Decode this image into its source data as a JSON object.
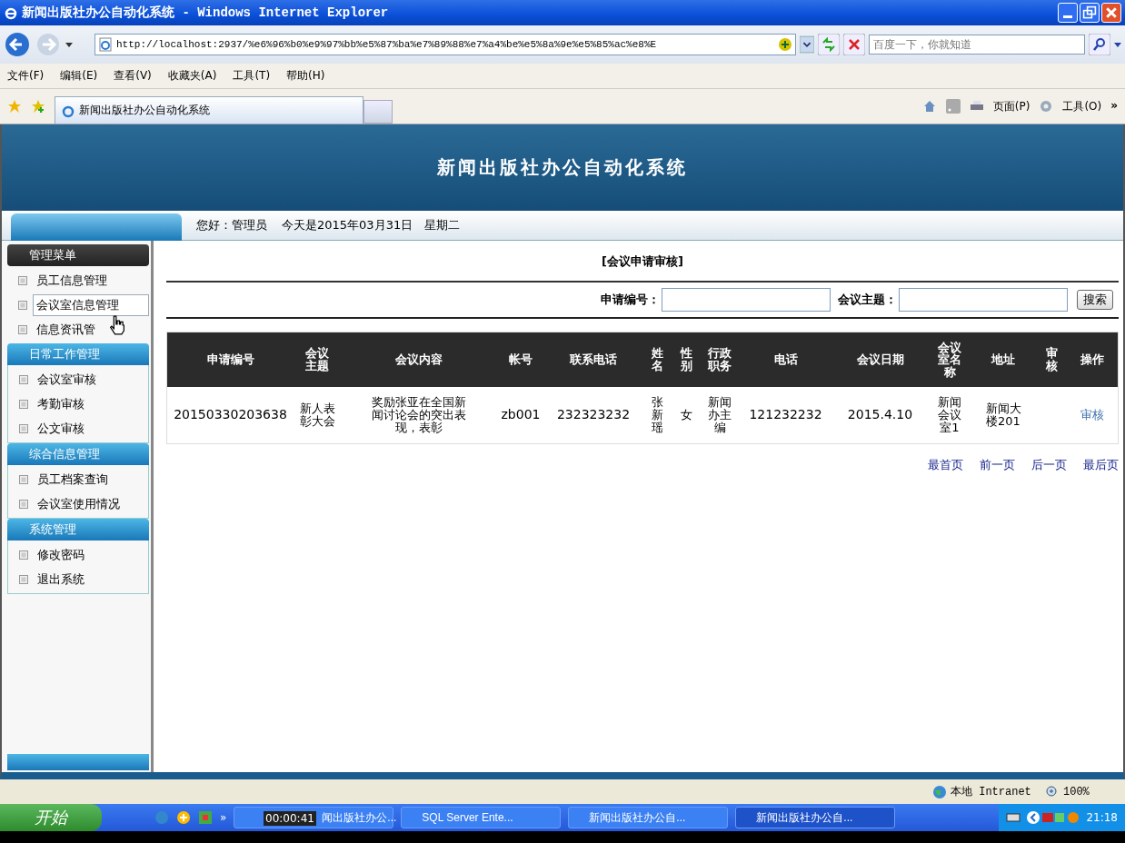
{
  "window": {
    "title": "新闻出版社办公自动化系统 - Windows Internet Explorer"
  },
  "address_bar": {
    "url": "http://localhost:2937/%e6%96%b0%e9%97%bb%e5%87%ba%e7%89%88%e7%a4%be%e5%8a%9e%e5%85%ac%e8%E",
    "search_placeholder": "百度一下，你就知道"
  },
  "menu_bar": [
    "文件(F)",
    "编辑(E)",
    "查看(V)",
    "收藏夹(A)",
    "工具(T)",
    "帮助(H)"
  ],
  "tab": {
    "label": "新闻出版社办公自动化系统"
  },
  "command_bar": {
    "page": "页面(P)",
    "tools": "工具(O)",
    "more": "»"
  },
  "site": {
    "title": "新闻出版社办公自动化系统",
    "greeting": "您好：管理员",
    "date": "今天是2015年03月31日　星期二"
  },
  "sidebar": [
    {
      "title": "管理菜单",
      "kind": "dark",
      "items": [
        {
          "label": "员工信息管理",
          "selected": false
        },
        {
          "label": "会议室信息管理",
          "selected": true
        },
        {
          "label": "信息资讯管",
          "selected": false
        }
      ]
    },
    {
      "title": "日常工作管理",
      "kind": "blue",
      "items": [
        {
          "label": "会议室审核",
          "selected": false
        },
        {
          "label": "考勤审核",
          "selected": false
        },
        {
          "label": "公文审核",
          "selected": false
        }
      ]
    },
    {
      "title": "综合信息管理",
      "kind": "blue",
      "items": [
        {
          "label": "员工档案查询",
          "selected": false
        },
        {
          "label": "会议室使用情况",
          "selected": false
        }
      ]
    },
    {
      "title": "系统管理",
      "kind": "blue",
      "items": [
        {
          "label": "修改密码",
          "selected": false
        },
        {
          "label": "退出系统",
          "selected": false
        }
      ]
    }
  ],
  "content": {
    "title": "[会议申请审核]",
    "search": {
      "fields": [
        {
          "label": "申请编号："
        },
        {
          "label": "会议主题："
        }
      ],
      "button": "搜索"
    },
    "table": {
      "columns": [
        "申请编号",
        "会议主题",
        "会议内容",
        "帐号",
        "联系电话",
        "姓名",
        "性别",
        "行政职务",
        "电话",
        "会议日期",
        "会议室名称",
        "地址",
        "审核",
        "操作"
      ],
      "rows": [
        {
          "cells": [
            "20150330203638",
            "新人表彰大会",
            "奖励张亚在全国新闻讨论会的突出表现，表彰",
            "zb001",
            "232323232",
            "张新瑶",
            "女",
            "新闻办主编",
            "121232232",
            "2015.4.10",
            "新闻会议室1",
            "新闻大楼201",
            ""
          ],
          "action": "审核"
        }
      ]
    },
    "pagination": [
      "最首页",
      "前一页",
      "后一页",
      "最后页"
    ]
  },
  "status_bar": {
    "zone": "本地 Intranet",
    "zoom": "100%"
  },
  "taskbar": {
    "start": "开始",
    "more": "»",
    "tasks": [
      {
        "label": "闻出版社办公...",
        "selected": false
      },
      {
        "label": "SQL Server Ente...",
        "selected": false
      },
      {
        "label": "新闻出版社办公自...",
        "selected": false
      },
      {
        "label": "新闻出版社办公自...",
        "selected": true
      }
    ],
    "clock": "21:18"
  },
  "video_overlay": {
    "time": "00:00:41"
  }
}
